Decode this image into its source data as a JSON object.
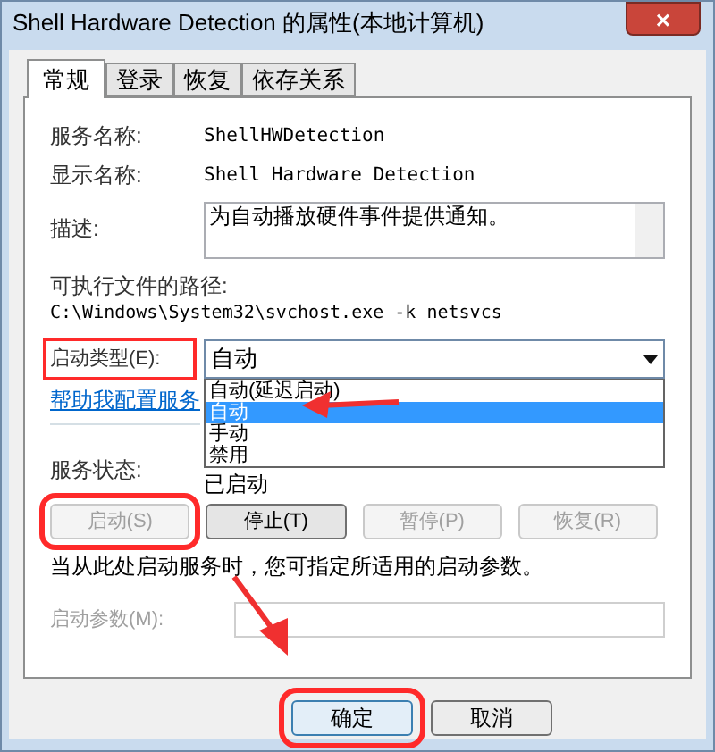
{
  "window": {
    "title": "Shell Hardware Detection 的属性(本地计算机)",
    "close": "×"
  },
  "tabs": [
    {
      "label": "常规",
      "selected": true
    },
    {
      "label": "登录",
      "selected": false
    },
    {
      "label": "恢复",
      "selected": false
    },
    {
      "label": "依存关系",
      "selected": false
    }
  ],
  "fields": [
    {
      "label": "服务名称:",
      "value": "ShellHWDetection"
    },
    {
      "label": "显示名称:",
      "value": "Shell Hardware Detection"
    }
  ],
  "description": {
    "label": "描述:",
    "value": "为自动播放硬件事件提供通知。"
  },
  "path": {
    "label": "可执行文件的路径:",
    "value": "C:\\Windows\\System32\\svchost.exe -k netsvcs"
  },
  "startup_type": {
    "label": "启动类型(E):",
    "highlighted": true,
    "value": "自动",
    "expanded": true,
    "options": [
      {
        "label": "自动(延迟启动)",
        "selected": false
      },
      {
        "label": "自动",
        "selected": true
      },
      {
        "label": "手动",
        "selected": false
      },
      {
        "label": "禁用",
        "selected": false
      }
    ]
  },
  "help_link": "帮助我配置服务",
  "service_status": {
    "label": "服务状态:",
    "value": "已启动"
  },
  "service_buttons": [
    {
      "label": "启动(S)",
      "disabled": true,
      "highlighted": true
    },
    {
      "label": "停止(T)",
      "disabled": false,
      "highlighted": false
    },
    {
      "label": "暂停(P)",
      "disabled": true,
      "highlighted": false
    },
    {
      "label": "恢复(R)",
      "disabled": true,
      "highlighted": false
    }
  ],
  "hint": "当从此处启动服务时，您可指定所适用的启动参数。",
  "start_params": {
    "label": "启动参数(M):",
    "disabled": true
  },
  "dialog_buttons": [
    {
      "label": "确定",
      "highlighted": true,
      "default": true
    },
    {
      "label": "取消",
      "highlighted": false,
      "default": false
    }
  ]
}
